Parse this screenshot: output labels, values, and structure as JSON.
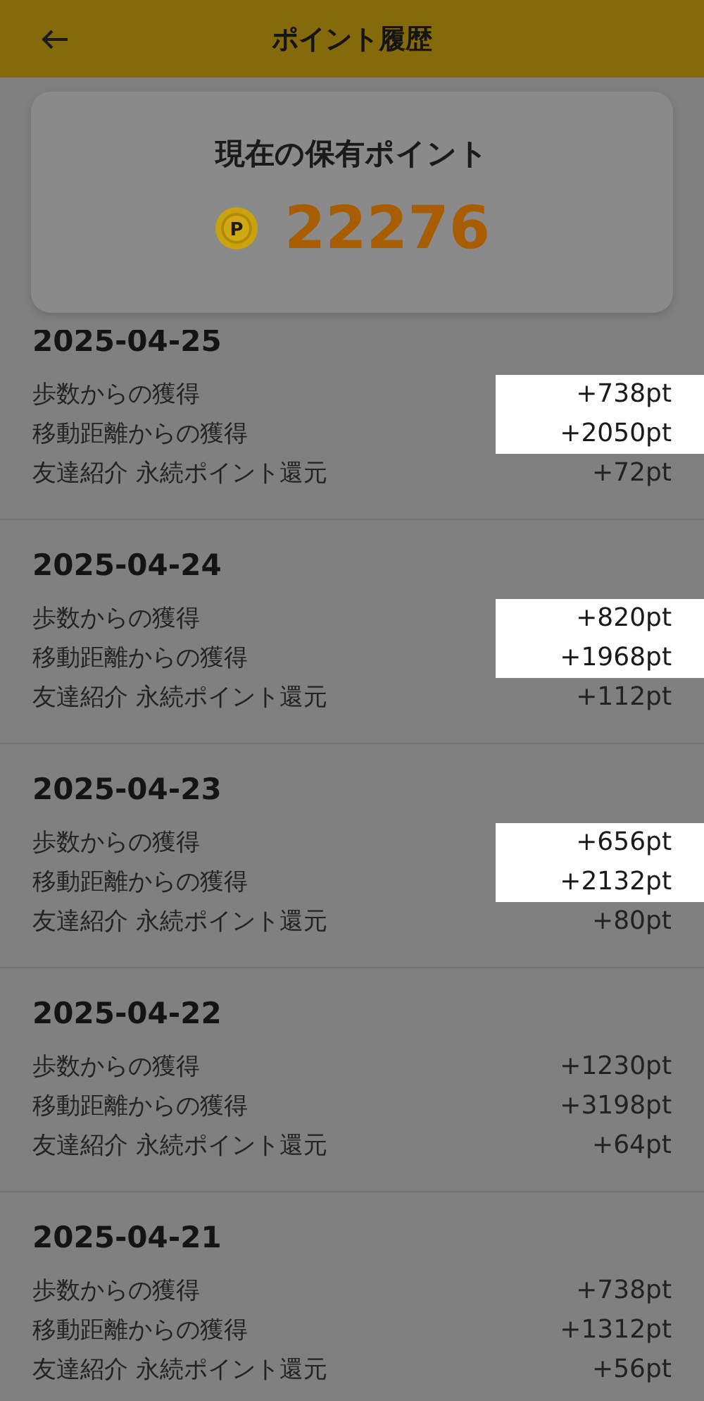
{
  "header": {
    "title": "ポイント履歴"
  },
  "balance": {
    "title": "現在の保有ポイント",
    "coin_label": "P",
    "points": "22276"
  },
  "history": [
    {
      "date": "2025-04-25",
      "items": [
        {
          "label": "歩数からの獲得",
          "value": "+738pt",
          "highlighted": true
        },
        {
          "label": "移動距離からの獲得",
          "value": "+2050pt",
          "highlighted": true
        },
        {
          "label": "友達紹介 永続ポイント還元",
          "value": "+72pt",
          "highlighted": false
        }
      ]
    },
    {
      "date": "2025-04-24",
      "items": [
        {
          "label": "歩数からの獲得",
          "value": "+820pt",
          "highlighted": true
        },
        {
          "label": "移動距離からの獲得",
          "value": "+1968pt",
          "highlighted": true
        },
        {
          "label": "友達紹介 永続ポイント還元",
          "value": "+112pt",
          "highlighted": false
        }
      ]
    },
    {
      "date": "2025-04-23",
      "items": [
        {
          "label": "歩数からの獲得",
          "value": "+656pt",
          "highlighted": true
        },
        {
          "label": "移動距離からの獲得",
          "value": "+2132pt",
          "highlighted": true
        },
        {
          "label": "友達紹介 永続ポイント還元",
          "value": "+80pt",
          "highlighted": false
        }
      ]
    },
    {
      "date": "2025-04-22",
      "items": [
        {
          "label": "歩数からの獲得",
          "value": "+1230pt",
          "highlighted": false
        },
        {
          "label": "移動距離からの獲得",
          "value": "+3198pt",
          "highlighted": false
        },
        {
          "label": "友達紹介 永続ポイント還元",
          "value": "+64pt",
          "highlighted": false
        }
      ]
    },
    {
      "date": "2025-04-21",
      "items": [
        {
          "label": "歩数からの獲得",
          "value": "+738pt",
          "highlighted": false
        },
        {
          "label": "移動距離からの獲得",
          "value": "+1312pt",
          "highlighted": false
        },
        {
          "label": "友達紹介 永続ポイント還元",
          "value": "+56pt",
          "highlighted": false
        }
      ]
    }
  ]
}
